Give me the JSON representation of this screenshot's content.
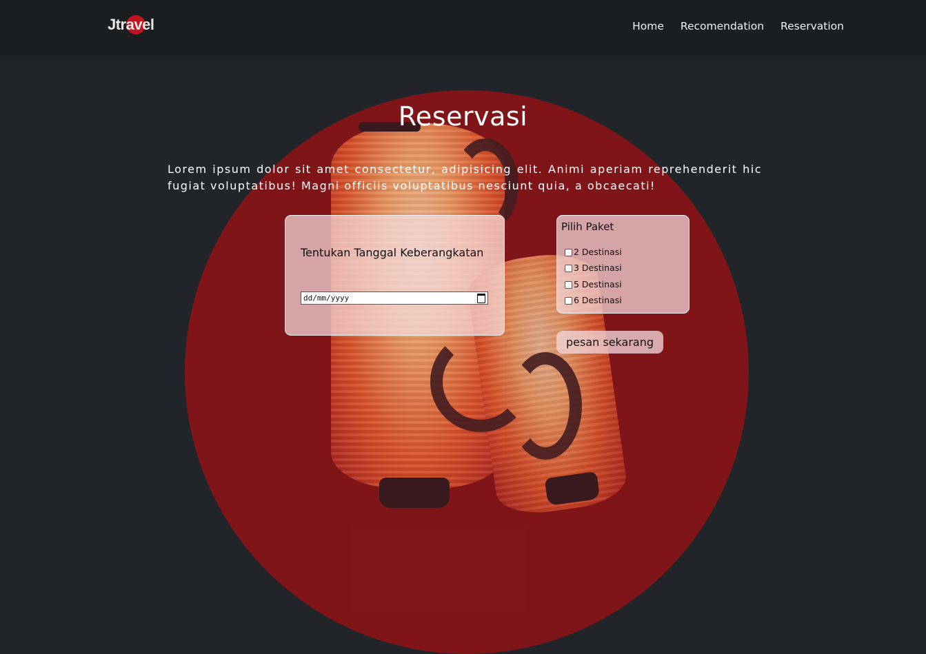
{
  "navbar": {
    "brand": "Jtravel",
    "links": [
      {
        "label": "Home"
      },
      {
        "label": "Recomendation"
      },
      {
        "label": "Reservation"
      }
    ]
  },
  "hero": {
    "title": "Reservasi",
    "description": "Lorem ipsum dolor sit amet consectetur, adipisicing elit. Animi aperiam reprehenderit hic fugiat voluptatibus! Magni officiis voluptatibus nesciunt quia, a obcaecati!"
  },
  "date_form": {
    "label": "Tentukan Tanggal Keberangkatan",
    "placeholder": "dd/mm/yyyy"
  },
  "package_form": {
    "title": "Pilih Paket",
    "options": [
      {
        "label": "2 Destinasi",
        "checked": false
      },
      {
        "label": "3 Destinasi",
        "checked": false
      },
      {
        "label": "5 Destinasi",
        "checked": false
      },
      {
        "label": "6 Destinasi",
        "checked": false
      }
    ]
  },
  "submit": {
    "label": "pesan sekarang"
  },
  "colors": {
    "navbar_bg": "#1b1e21",
    "page_bg": "#212529",
    "accent_red": "#c1121f",
    "circle_red": "#761619",
    "card_bg": "#f5dcde"
  },
  "icons": {
    "calendar": "calendar-icon"
  }
}
